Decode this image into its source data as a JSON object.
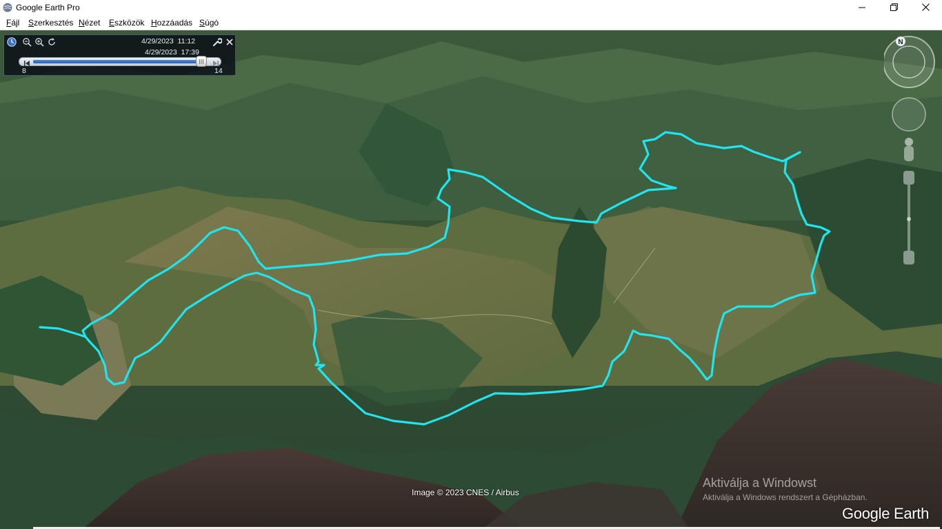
{
  "window": {
    "title": "Google Earth Pro",
    "controls": [
      "minimize-icon",
      "maximize-icon",
      "close-icon"
    ]
  },
  "menu": [
    {
      "label": "Fájl"
    },
    {
      "label": "Szerkesztés"
    },
    {
      "label": "Nézet"
    },
    {
      "label": "Eszközök"
    },
    {
      "label": "Hozzáadás"
    },
    {
      "label": "Súgó"
    }
  ],
  "time_slider": {
    "start_label": "4/29/2023  11:12",
    "end_label": "4/29/2023  17:39",
    "min_label": "8",
    "max_label": "14",
    "position": 0.97,
    "icons": [
      "clock-icon",
      "zoom-out-icon",
      "zoom-in-icon",
      "refresh-icon",
      "wrench-icon",
      "close-icon",
      "skip-back-icon",
      "skip-forward-icon"
    ]
  },
  "map": {
    "track_color": "#22e4ee",
    "credit": "Image © 2023 CNES / Airbus"
  },
  "navigation": {
    "compass_label": "N",
    "icons": [
      "compass-icon",
      "look-joystick-icon",
      "move-joystick-icon",
      "pegman-icon",
      "zoom-slider-icon"
    ]
  },
  "watermark": {
    "title": "Aktiválja a Windowst",
    "subtitle": "Aktiválja a Windows rendszert a Gépházban."
  },
  "brand": "Google Earth"
}
